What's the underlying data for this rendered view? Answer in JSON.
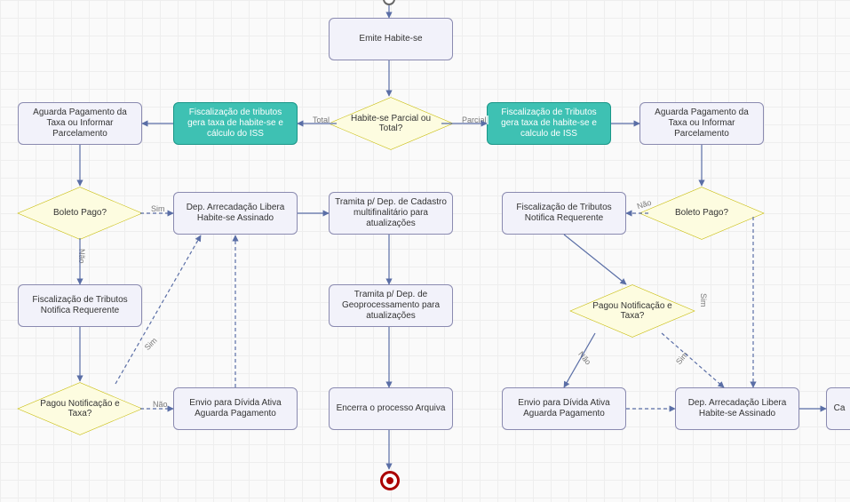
{
  "nodes": {
    "emite": "Emite Habite-se",
    "habParcial": "Habite-se Parcial ou Total?",
    "fiscTotal": "Fiscalização de tributos gera taxa de habite-se e cálculo do ISS",
    "fiscParcial": "Fiscalização de Tributos gera taxa de habite-se e calculo de ISS",
    "aguardaL": "Aguarda Pagamento da Taxa ou Informar Parcelamento",
    "aguardaR": "Aguarda Pagamento da Taxa ou Informar Parcelamento",
    "boletoL": "Boleto Pago?",
    "boletoR": "Boleto Pago?",
    "depArrecL": "Dep. Arrecadação Libera Habite-se Assinado",
    "depArrecR": "Dep. Arrecadação Libera Habite-se Assinado",
    "tramitaCad": "Tramita p/ Dep. de Cadastro multifinalitário para atualizações",
    "fiscNotifL": "Fiscalização de Tributos Notifica Requerente",
    "fiscNotifR": "Fiscalização de Tributos Notifica Requerente",
    "pagouL": "Pagou Notificação e Taxa?",
    "pagouR": "Pagou Notificação e Taxa?",
    "tramitaGeo": "Tramita p/ Dep. de Geoprocessamento para atualizações",
    "envioDividaL": "Envio para Dívida Ativa Aguarda Pagamento",
    "envioDividaR": "Envio para Dívida Ativa Aguarda Pagamento",
    "encerra": "Encerra o processo Arquiva",
    "caStub": "Ca"
  },
  "labels": {
    "total": "Total",
    "parcial": "Parcial",
    "sim": "Sim",
    "nao": "Não"
  }
}
